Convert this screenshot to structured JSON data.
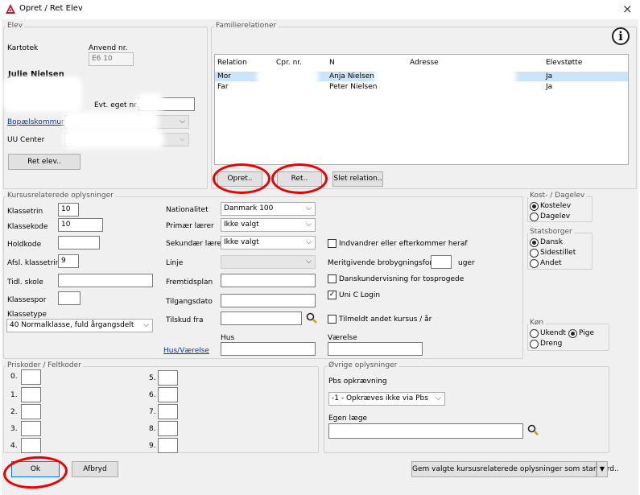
{
  "window": {
    "title": "Opret / Ret Elev",
    "close_symbol": "×"
  },
  "elev": {
    "legend": "Elev",
    "kartotek_label": "Kartotek",
    "anvend_label": "Anvend nr.",
    "anvend_value": "E6   10",
    "student_name": "Julie Nielsen",
    "evt_label": "Evt. eget nr.:",
    "bopael_label": "Bopælskommune",
    "uu_label": "UU Center",
    "ret_button": "Ret elev.."
  },
  "familie": {
    "legend": "Familierelationer",
    "columns": [
      "Relation",
      "Cpr. nr.",
      "N",
      "Adresse",
      "Elevstøtte"
    ],
    "rows": [
      {
        "relation": "Mor",
        "name": "Anja  Nielsen",
        "elevstotte": "Ja"
      },
      {
        "relation": "Far",
        "name": "Peter Nielsen",
        "elevstotte": "Ja"
      }
    ],
    "opret_button": "Opret..",
    "ret_button": "Ret..",
    "slet_button": "Slet relation.."
  },
  "kursus": {
    "legend": "Kursusrelaterede oplysninger",
    "klassetrin_label": "Klassetrin",
    "klassetrin_value": "10",
    "klassekode_label": "Klassekode",
    "klassekode_value": "10",
    "holdkode_label": "Holdkode",
    "afsl_label": "Afsl. klassetrin",
    "afsl_value": "9",
    "tidl_label": "Tidl. skole",
    "klassespor_label": "Klassespor",
    "klassetype_label": "Klassetype",
    "klassetype_value": "40 Normalklasse, fuld årgangsdelt",
    "nationalitet_label": "Nationalitet",
    "nationalitet_value": "Danmark 100",
    "primaer_label": "Primær lærer",
    "primaer_value": "Ikke valgt",
    "sekundaer_label": "Sekundær lærer",
    "sekundaer_value": "Ikke valgt",
    "linje_label": "Linje",
    "fremtid_label": "Fremtidsplan",
    "tilgang_label": "Tilgangsdato",
    "tilskud_label": "Tilskud fra",
    "hus_label": "Hus",
    "husvaer_label": "Hus/Værelse",
    "vaerelse_label": "Værelse",
    "indvandrer_label": "Indvandrer eller efterkommer heraf",
    "merit_label": "Meritgivende brobygningsforløb",
    "uger_label": "uger",
    "danskund_label": "Danskundervisning for tosprogede",
    "unic_label": "Uni C Login",
    "tilmeldt_label": "Tilmeldt andet kursus / år"
  },
  "kost": {
    "legend": "Kost- / Dagelev",
    "kostelev": "Kostelev",
    "dagelev": "Dagelev"
  },
  "statsborger": {
    "legend": "Statsborger",
    "dansk": "Dansk",
    "sidestillet": "Sidestillet",
    "andet": "Andet"
  },
  "kon": {
    "legend": "Køn",
    "ukendt": "Ukendt",
    "pige": "Pige",
    "dreng": "Dreng"
  },
  "priskoder": {
    "legend": "Priskoder / Feltkoder",
    "labels": [
      "0.",
      "1.",
      "2.",
      "3.",
      "4.",
      "5.",
      "6.",
      "7.",
      "8.",
      "9."
    ]
  },
  "ovrige": {
    "legend": "Øvrige oplysninger",
    "pbs_label": "Pbs opkrævning",
    "pbs_value": "-1  - Opkræves ikke via Pbs",
    "laege_label": "Egen læge"
  },
  "footer": {
    "ok_button": "Ok",
    "afbryd_button": "Afbryd",
    "gem_button": "Gem valgte kursusrelaterede oplysninger som standard..",
    "dropdown_arrow": "▼"
  },
  "glyphs": {
    "chevron": "⌵",
    "info": "i",
    "check": "✓"
  },
  "colors": {
    "highlight_row": "#cce4f7",
    "annotation_red": "#ee0000",
    "link_blue": "#0033cc"
  }
}
